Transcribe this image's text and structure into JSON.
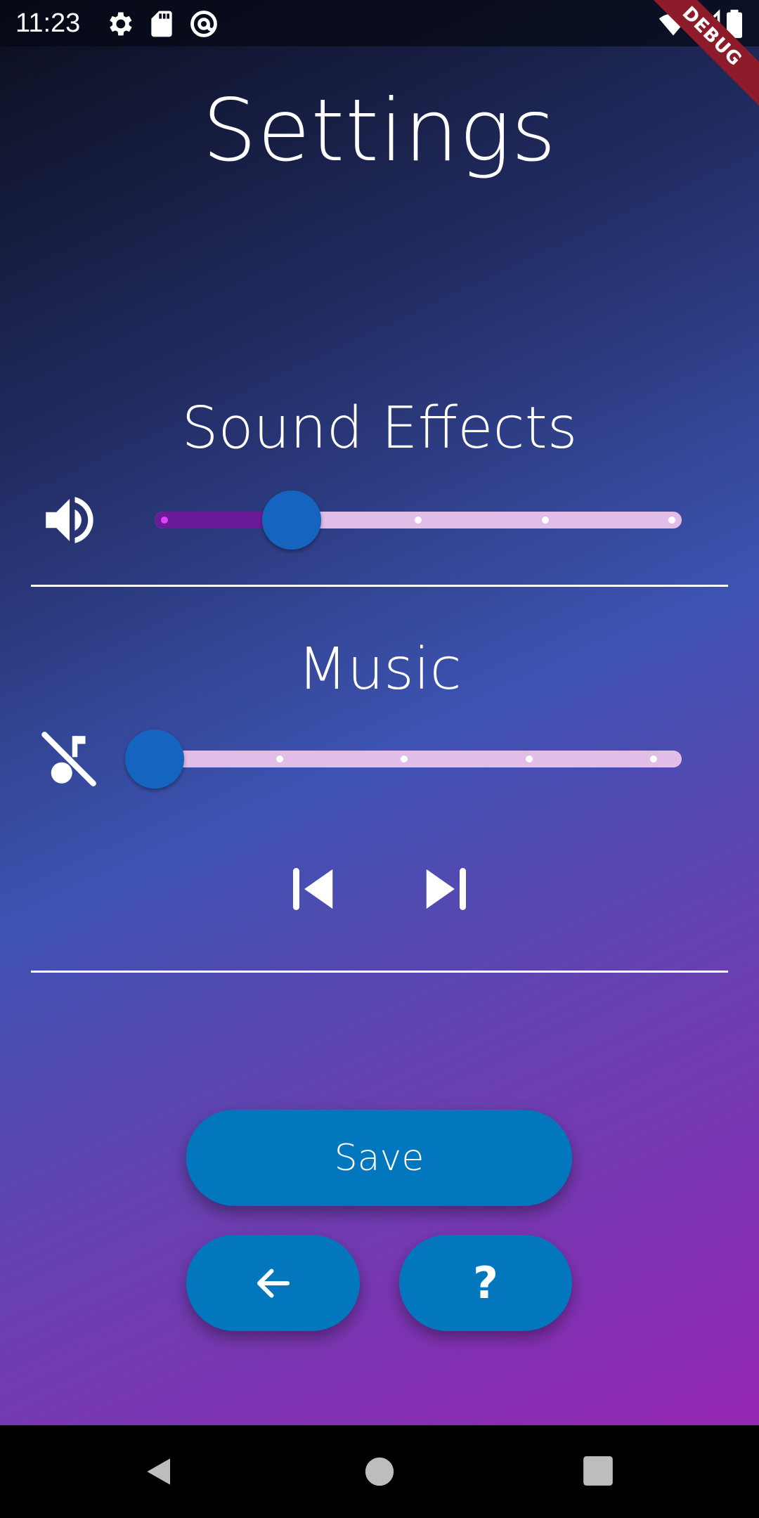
{
  "status_bar": {
    "time": "11:23",
    "icons": [
      "gear-icon",
      "sd-card-icon",
      "at-sign-icon",
      "wifi-icon",
      "signal-icon",
      "battery-icon"
    ],
    "debug_banner": "DEBUG"
  },
  "page": {
    "title": "Settings"
  },
  "sound_effects": {
    "label": "Sound Effects",
    "icon": "volume-up-icon",
    "slider": {
      "value": 1,
      "min": 0,
      "max": 4,
      "divisions": 4
    }
  },
  "music": {
    "label": "Music",
    "icon": "music-off-icon",
    "slider": {
      "value": 0,
      "min": 0,
      "max": 4,
      "divisions": 4
    },
    "controls": [
      "skip-previous-icon",
      "skip-next-icon"
    ]
  },
  "actions": {
    "save_label": "Save",
    "back_icon": "arrow-back-icon",
    "help_label": "?"
  },
  "system_nav": [
    "back-triangle-icon",
    "home-circle-icon",
    "recents-square-icon"
  ],
  "colors": {
    "button": "#0277bd",
    "slider_thumb": "#1565c0",
    "slider_active": "#6a1b9a",
    "slider_inactive": "#e1bee7",
    "debug_banner": "#8e1b2a"
  }
}
